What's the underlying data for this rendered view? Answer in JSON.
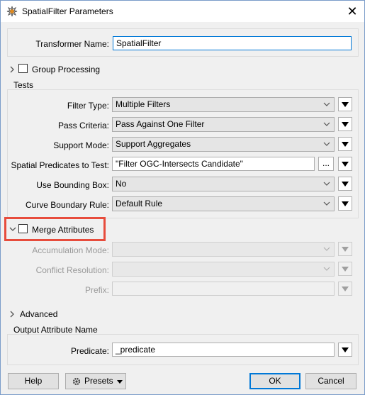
{
  "window": {
    "title": "SpatialFilter Parameters",
    "close_glyph": "✕"
  },
  "transformer": {
    "label": "Transformer Name:",
    "value": "SpatialFilter"
  },
  "group_processing": {
    "label": "Group Processing"
  },
  "tests": {
    "title": "Tests",
    "filter_type": {
      "label": "Filter Type:",
      "value": "Multiple Filters"
    },
    "pass_criteria": {
      "label": "Pass Criteria:",
      "value": "Pass Against One Filter"
    },
    "support_mode": {
      "label": "Support Mode:",
      "value": "Support Aggregates"
    },
    "spatial_predicates": {
      "label": "Spatial Predicates to Test:",
      "value": "\"Filter OGC-Intersects Candidate\"",
      "browse": "..."
    },
    "use_bounding_box": {
      "label": "Use Bounding Box:",
      "value": "No"
    },
    "curve_boundary": {
      "label": "Curve Boundary Rule:",
      "value": "Default Rule"
    }
  },
  "merge": {
    "label": "Merge Attributes",
    "accumulation_mode": {
      "label": "Accumulation Mode:"
    },
    "conflict_resolution": {
      "label": "Conflict Resolution:"
    },
    "prefix": {
      "label": "Prefix:"
    }
  },
  "advanced": {
    "label": "Advanced"
  },
  "output": {
    "title": "Output Attribute Name",
    "predicate": {
      "label": "Predicate:",
      "value": "_predicate"
    }
  },
  "footer": {
    "help": "Help",
    "presets": "Presets",
    "ok": "OK",
    "cancel": "Cancel"
  },
  "colors": {
    "highlight": "#e74c3c",
    "focus": "#0078d7"
  },
  "icons": [
    "fme-transformer-icon",
    "close-icon",
    "chevron-down-icon",
    "dropdown-arrow-icon",
    "expand-right-icon",
    "collapse-down-icon",
    "gear-icon"
  ]
}
